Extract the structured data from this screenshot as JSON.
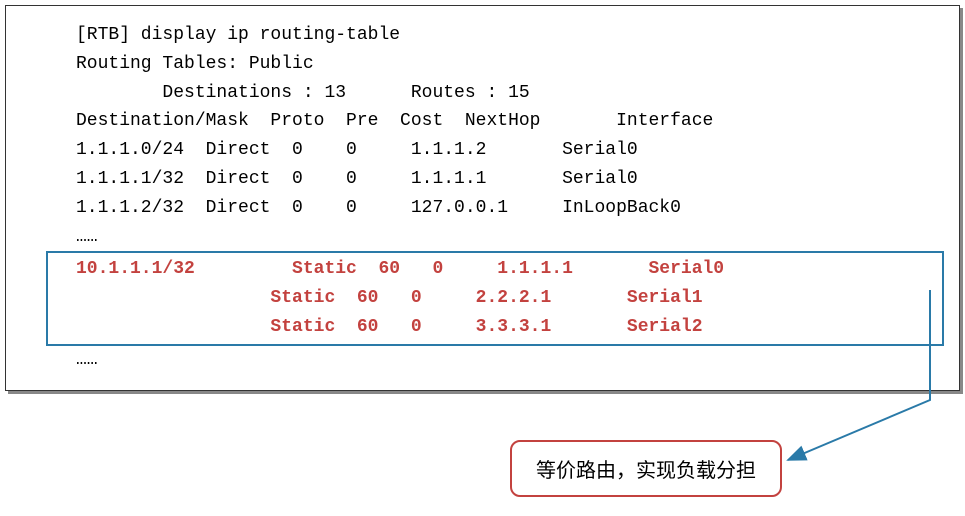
{
  "cmd_prompt": "[RTB] display ip routing-table",
  "header1": "Routing Tables: Public",
  "header2": "        Destinations : 13      Routes : 15",
  "columns": "Destination/Mask  Proto  Pre  Cost  NextHop       Interface",
  "rows": {
    "r1": "1.1.1.0/24  Direct  0    0     1.1.1.2       Serial0",
    "r2": "1.1.1.1/32  Direct  0    0     1.1.1.1       Serial0",
    "r3": "1.1.1.2/32  Direct  0    0     127.0.0.1     InLoopBack0"
  },
  "dots1": "……",
  "highlighted": {
    "r4": "10.1.1.1/32         Static  60   0     1.1.1.1       Serial0",
    "r5": "                  Static  60   0     2.2.2.1       Serial1",
    "r6": "                  Static  60   0     3.3.3.1       Serial2"
  },
  "dots2": "……",
  "callout": "等价路由，实现负载分担",
  "chart_data": {
    "type": "table",
    "title": "IP Routing Table",
    "columns": [
      "Destination/Mask",
      "Proto",
      "Pre",
      "Cost",
      "NextHop",
      "Interface"
    ],
    "summary": {
      "destinations": 13,
      "routes": 15,
      "table": "Public"
    },
    "rows": [
      {
        "dest": "1.1.1.0/24",
        "proto": "Direct",
        "pre": 0,
        "cost": 0,
        "nexthop": "1.1.1.2",
        "iface": "Serial0"
      },
      {
        "dest": "1.1.1.1/32",
        "proto": "Direct",
        "pre": 0,
        "cost": 0,
        "nexthop": "1.1.1.1",
        "iface": "Serial0"
      },
      {
        "dest": "1.1.1.2/32",
        "proto": "Direct",
        "pre": 0,
        "cost": 0,
        "nexthop": "127.0.0.1",
        "iface": "InLoopBack0"
      },
      {
        "dest": "10.1.1.1/32",
        "proto": "Static",
        "pre": 60,
        "cost": 0,
        "nexthop": "1.1.1.1",
        "iface": "Serial0",
        "highlight": true
      },
      {
        "dest": "10.1.1.1/32",
        "proto": "Static",
        "pre": 60,
        "cost": 0,
        "nexthop": "2.2.2.1",
        "iface": "Serial1",
        "highlight": true
      },
      {
        "dest": "10.1.1.1/32",
        "proto": "Static",
        "pre": 60,
        "cost": 0,
        "nexthop": "3.3.3.1",
        "iface": "Serial2",
        "highlight": true
      }
    ],
    "annotation": "等价路由，实现负载分担"
  }
}
